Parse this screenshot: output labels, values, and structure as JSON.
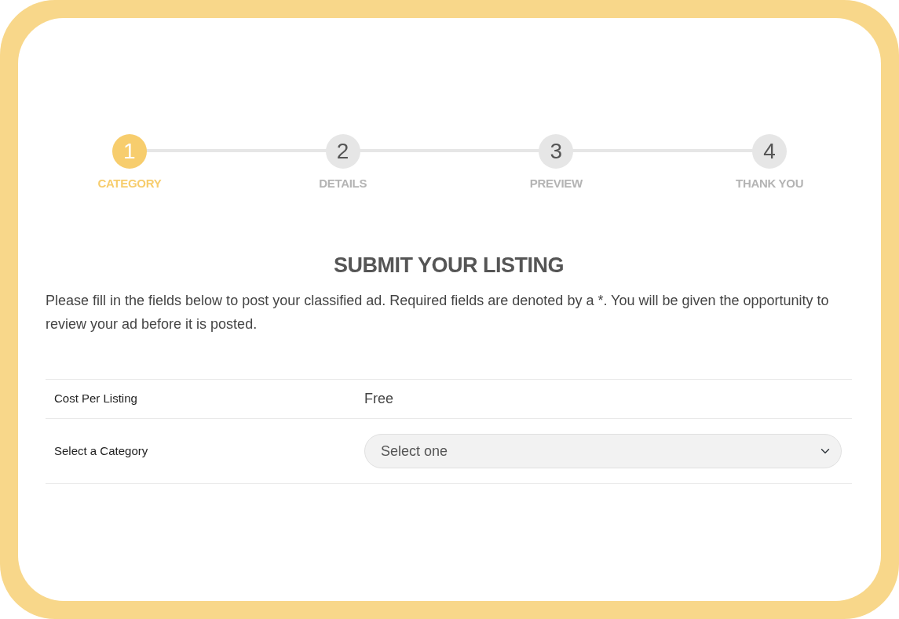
{
  "steps": [
    {
      "number": "1",
      "label": "CATEGORY",
      "selected": true
    },
    {
      "number": "2",
      "label": "DETAILS",
      "selected": false
    },
    {
      "number": "3",
      "label": "PREVIEW",
      "selected": false
    },
    {
      "number": "4",
      "label": "THANK YOU",
      "selected": false
    }
  ],
  "heading": "SUBMIT YOUR LISTING",
  "intro": "Please fill in the fields below to post your classified ad. Required fields are denoted by a *. You will be given the opportunity to review your ad before it is posted.",
  "form_rows": [
    {
      "kind": "text",
      "label": "Cost Per Listing",
      "value": "Free"
    },
    {
      "kind": "select",
      "label": "Select a Category",
      "value": "Select one"
    }
  ]
}
